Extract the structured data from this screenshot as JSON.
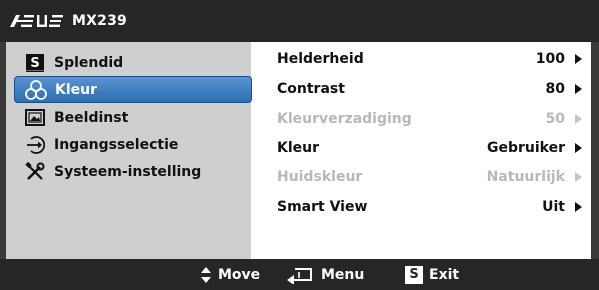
{
  "header": {
    "brand": "ASUS",
    "model": "MX239"
  },
  "menu": {
    "items": [
      {
        "label": "Splendid",
        "icon": "splendid-s-icon",
        "selected": false
      },
      {
        "label": "Kleur",
        "icon": "color-circles-icon",
        "selected": true
      },
      {
        "label": "Beeldinst",
        "icon": "image-setup-icon",
        "selected": false
      },
      {
        "label": "Ingangsselectie",
        "icon": "input-select-icon",
        "selected": false
      },
      {
        "label": "Systeem-instelling",
        "icon": "tools-icon",
        "selected": false
      }
    ]
  },
  "settings": {
    "rows": [
      {
        "label": "Helderheid",
        "value": "100",
        "enabled": true
      },
      {
        "label": "Contrast",
        "value": "80",
        "enabled": true
      },
      {
        "label": "Kleurverzadiging",
        "value": "50",
        "enabled": false
      },
      {
        "label": "Kleur",
        "value": "Gebruiker",
        "enabled": true
      },
      {
        "label": "Huidskleur",
        "value": "Natuurlijk",
        "enabled": false
      },
      {
        "label": "Smart View",
        "value": "Uit",
        "enabled": true
      }
    ]
  },
  "footer": {
    "move": "Move",
    "menu": "Menu",
    "exit": "Exit",
    "exit_key": "S"
  },
  "colors": {
    "header_bg": "#262626",
    "left_panel_bg": "#cfcfcf",
    "selected_bg": "#3d7fc1",
    "disabled_text": "#b8b8b8"
  }
}
